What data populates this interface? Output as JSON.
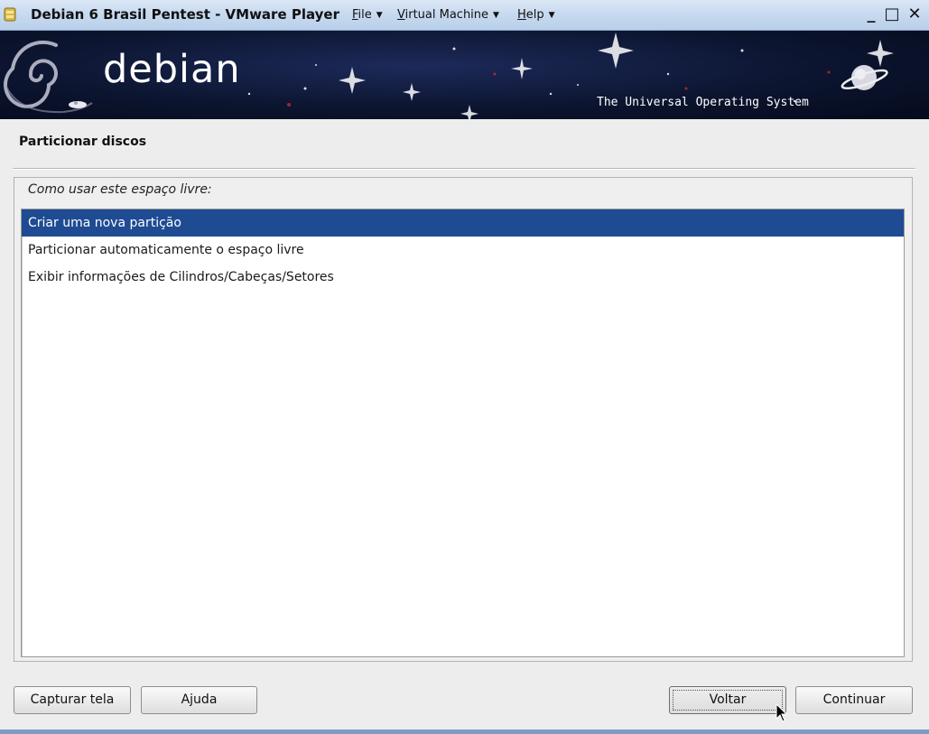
{
  "window": {
    "title": "Debian 6 Brasil Pentest - VMware Player",
    "menus": [
      {
        "label": "File",
        "accel": "F",
        "rest": "ile"
      },
      {
        "label": "Virtual Machine",
        "accel": "V",
        "rest": "irtual Machine"
      },
      {
        "label": "Help",
        "accel": "H",
        "rest": "elp"
      }
    ],
    "controls": {
      "minimize": "_",
      "maximize": "□",
      "close": "✕"
    }
  },
  "banner": {
    "logo_text": "debian",
    "tagline": "The Universal Operating System"
  },
  "installer": {
    "heading": "Particionar discos",
    "question": "Como usar este espaço livre:",
    "options": [
      {
        "label": "Criar uma nova partição",
        "selected": true
      },
      {
        "label": "Particionar automaticamente o espaço livre",
        "selected": false
      },
      {
        "label": "Exibir informações de Cilindros/Cabeças/Setores",
        "selected": false
      }
    ]
  },
  "buttons": {
    "screenshot": "Capturar tela",
    "help": "Ajuda",
    "back": "Voltar",
    "continue": "Continuar"
  },
  "colors": {
    "selection": "#1f4b93",
    "titlebar": "#c8daf0",
    "banner": "#0c1530"
  }
}
